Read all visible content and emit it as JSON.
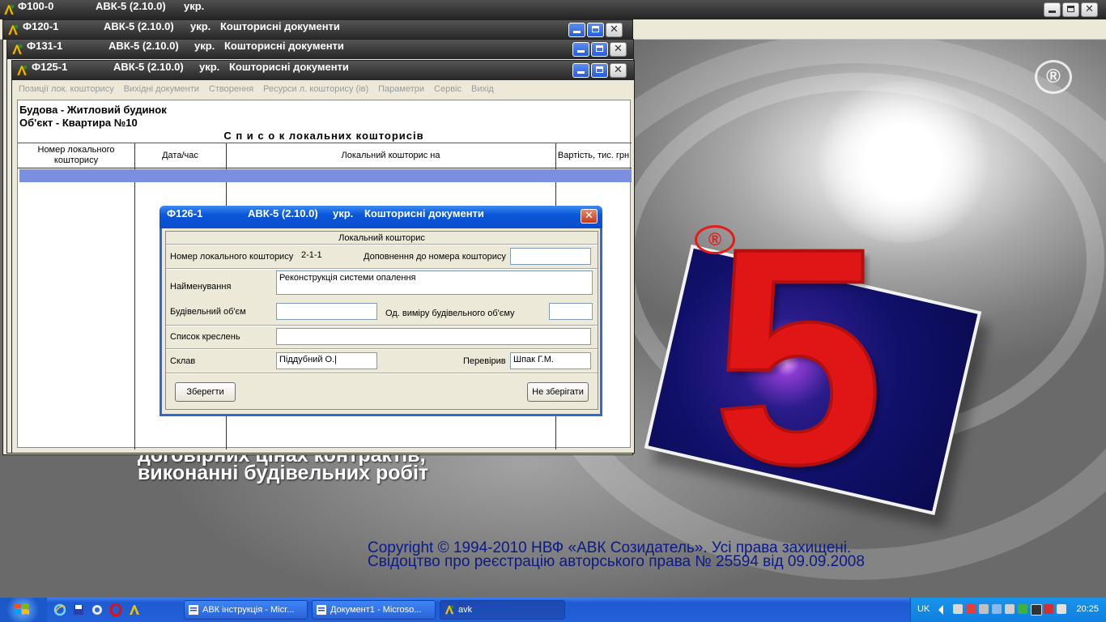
{
  "app": {
    "form_id": "Ф100-0",
    "product": "АВК-5 (2.10.0)",
    "lang": "укр."
  },
  "windows": [
    {
      "form_id": "Ф120-1",
      "product": "АВК-5 (2.10.0)",
      "lang": "укр.",
      "subtitle": "Кошторисні документи"
    },
    {
      "form_id": "Ф131-1",
      "product": "АВК-5 (2.10.0)",
      "lang": "укр.",
      "subtitle": "Кошторисні документи"
    },
    {
      "form_id": "Ф125-1",
      "product": "АВК-5 (2.10.0)",
      "lang": "укр.",
      "subtitle": "Кошторисні документи"
    }
  ],
  "menu": {
    "items": [
      "Позиції лок. кошторису",
      "Вихідні документи",
      "Створення",
      "Ресурси л. кошторису (ів)",
      "Параметри",
      "Сервіс",
      "Вихід"
    ]
  },
  "estimate_list": {
    "context_line1": "Будова - Житловий будинок",
    "context_line2": "Об'єкт - Квартира №10",
    "title": "С п и с о к   локальних кошторисів",
    "columns": [
      {
        "label": "Номер локального кошторису"
      },
      {
        "label": "Дата/час"
      },
      {
        "label": "Локальний кошторис на"
      },
      {
        "label": "Вартість, тис. грн"
      }
    ]
  },
  "dialog": {
    "form_id": "Ф126-1",
    "product": "АВК-5 (2.10.0)",
    "lang": "укр.",
    "subtitle": "Кошторисні документи",
    "section_title": "Локальний кошторис",
    "number_label": "Номер локального кошторису",
    "number_value": "2-1-1",
    "supplement_label": "Доповнення до номера кошторису",
    "supplement_value": "",
    "name_label": "Найменування",
    "name_value": "Реконструкція системи опалення",
    "volume_label": "Будівельний об'єм",
    "volume_value": "",
    "volume_unit_label": "Од. виміру будівельного об'єму",
    "volume_unit_value": "",
    "drawings_label": "Список креслень",
    "drawings_value": "",
    "compiled_label": "Склав",
    "compiled_value": "Піддубний О.|",
    "checked_label": "Перевірив",
    "checked_value": "Шпак Г.М.",
    "save_label": "Зберегти",
    "nosave_label": "Не зберігати"
  },
  "background": {
    "line1": "договірних цінах контрактів,",
    "line2": "виконанні будівельних робіт",
    "copyright1": "Copyright © 1994-2010 НВФ «АВК Созидатель». Усі права захищені.",
    "copyright2": "Свідоцтво про реєстрацію авторського права № 25594 від 09.09.2008",
    "logo_digit": "5",
    "registered_mark": "®"
  },
  "taskbar": {
    "tasks": [
      {
        "label": "АВК інструкція - Micr...",
        "icon": "word-icon",
        "active": false
      },
      {
        "label": "Документ1 - Microso...",
        "icon": "word-icon",
        "active": false
      },
      {
        "label": "avk",
        "icon": "avk-icon",
        "active": true
      }
    ],
    "lang": "UK",
    "clock": "20:25"
  },
  "colors": {
    "title_bar": "#2b2b2b",
    "dialog_title": "#0a57d8",
    "selection_row": "#7b8fe0",
    "logo_red": "#e01515",
    "taskbar_blue": "#2460d8"
  }
}
